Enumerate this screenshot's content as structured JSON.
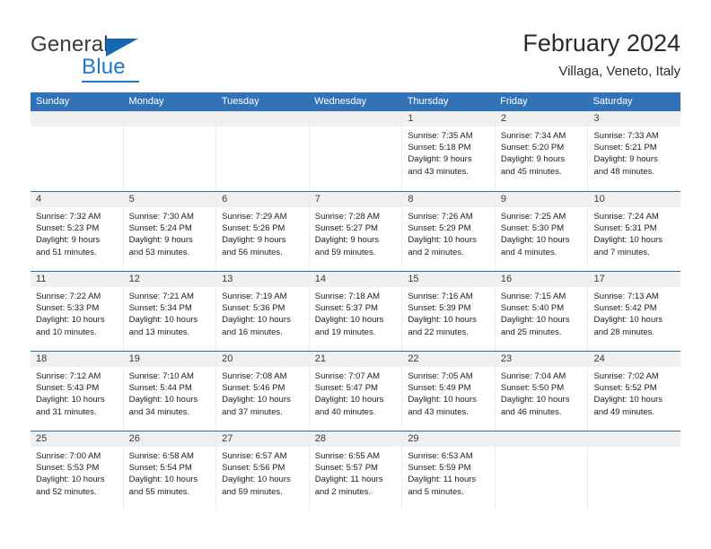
{
  "brand": {
    "name_top": "General",
    "name_bottom": "Blue",
    "accent_color": "#2277c8",
    "triangle_color": "#1667b2"
  },
  "header": {
    "title": "February 2024",
    "subtitle": "Villaga, Veneto, Italy"
  },
  "calendar": {
    "header_color": "#3273b8",
    "weekdays": [
      "Sunday",
      "Monday",
      "Tuesday",
      "Wednesday",
      "Thursday",
      "Friday",
      "Saturday"
    ],
    "weeks": [
      [
        {
          "day": "",
          "sunrise": "",
          "sunset": "",
          "daylight_line1": "",
          "daylight_line2": ""
        },
        {
          "day": "",
          "sunrise": "",
          "sunset": "",
          "daylight_line1": "",
          "daylight_line2": ""
        },
        {
          "day": "",
          "sunrise": "",
          "sunset": "",
          "daylight_line1": "",
          "daylight_line2": ""
        },
        {
          "day": "",
          "sunrise": "",
          "sunset": "",
          "daylight_line1": "",
          "daylight_line2": ""
        },
        {
          "day": "1",
          "sunrise": "Sunrise: 7:35 AM",
          "sunset": "Sunset: 5:18 PM",
          "daylight_line1": "Daylight: 9 hours",
          "daylight_line2": "and 43 minutes."
        },
        {
          "day": "2",
          "sunrise": "Sunrise: 7:34 AM",
          "sunset": "Sunset: 5:20 PM",
          "daylight_line1": "Daylight: 9 hours",
          "daylight_line2": "and 45 minutes."
        },
        {
          "day": "3",
          "sunrise": "Sunrise: 7:33 AM",
          "sunset": "Sunset: 5:21 PM",
          "daylight_line1": "Daylight: 9 hours",
          "daylight_line2": "and 48 minutes."
        }
      ],
      [
        {
          "day": "4",
          "sunrise": "Sunrise: 7:32 AM",
          "sunset": "Sunset: 5:23 PM",
          "daylight_line1": "Daylight: 9 hours",
          "daylight_line2": "and 51 minutes."
        },
        {
          "day": "5",
          "sunrise": "Sunrise: 7:30 AM",
          "sunset": "Sunset: 5:24 PM",
          "daylight_line1": "Daylight: 9 hours",
          "daylight_line2": "and 53 minutes."
        },
        {
          "day": "6",
          "sunrise": "Sunrise: 7:29 AM",
          "sunset": "Sunset: 5:26 PM",
          "daylight_line1": "Daylight: 9 hours",
          "daylight_line2": "and 56 minutes."
        },
        {
          "day": "7",
          "sunrise": "Sunrise: 7:28 AM",
          "sunset": "Sunset: 5:27 PM",
          "daylight_line1": "Daylight: 9 hours",
          "daylight_line2": "and 59 minutes."
        },
        {
          "day": "8",
          "sunrise": "Sunrise: 7:26 AM",
          "sunset": "Sunset: 5:29 PM",
          "daylight_line1": "Daylight: 10 hours",
          "daylight_line2": "and 2 minutes."
        },
        {
          "day": "9",
          "sunrise": "Sunrise: 7:25 AM",
          "sunset": "Sunset: 5:30 PM",
          "daylight_line1": "Daylight: 10 hours",
          "daylight_line2": "and 4 minutes."
        },
        {
          "day": "10",
          "sunrise": "Sunrise: 7:24 AM",
          "sunset": "Sunset: 5:31 PM",
          "daylight_line1": "Daylight: 10 hours",
          "daylight_line2": "and 7 minutes."
        }
      ],
      [
        {
          "day": "11",
          "sunrise": "Sunrise: 7:22 AM",
          "sunset": "Sunset: 5:33 PM",
          "daylight_line1": "Daylight: 10 hours",
          "daylight_line2": "and 10 minutes."
        },
        {
          "day": "12",
          "sunrise": "Sunrise: 7:21 AM",
          "sunset": "Sunset: 5:34 PM",
          "daylight_line1": "Daylight: 10 hours",
          "daylight_line2": "and 13 minutes."
        },
        {
          "day": "13",
          "sunrise": "Sunrise: 7:19 AM",
          "sunset": "Sunset: 5:36 PM",
          "daylight_line1": "Daylight: 10 hours",
          "daylight_line2": "and 16 minutes."
        },
        {
          "day": "14",
          "sunrise": "Sunrise: 7:18 AM",
          "sunset": "Sunset: 5:37 PM",
          "daylight_line1": "Daylight: 10 hours",
          "daylight_line2": "and 19 minutes."
        },
        {
          "day": "15",
          "sunrise": "Sunrise: 7:16 AM",
          "sunset": "Sunset: 5:39 PM",
          "daylight_line1": "Daylight: 10 hours",
          "daylight_line2": "and 22 minutes."
        },
        {
          "day": "16",
          "sunrise": "Sunrise: 7:15 AM",
          "sunset": "Sunset: 5:40 PM",
          "daylight_line1": "Daylight: 10 hours",
          "daylight_line2": "and 25 minutes."
        },
        {
          "day": "17",
          "sunrise": "Sunrise: 7:13 AM",
          "sunset": "Sunset: 5:42 PM",
          "daylight_line1": "Daylight: 10 hours",
          "daylight_line2": "and 28 minutes."
        }
      ],
      [
        {
          "day": "18",
          "sunrise": "Sunrise: 7:12 AM",
          "sunset": "Sunset: 5:43 PM",
          "daylight_line1": "Daylight: 10 hours",
          "daylight_line2": "and 31 minutes."
        },
        {
          "day": "19",
          "sunrise": "Sunrise: 7:10 AM",
          "sunset": "Sunset: 5:44 PM",
          "daylight_line1": "Daylight: 10 hours",
          "daylight_line2": "and 34 minutes."
        },
        {
          "day": "20",
          "sunrise": "Sunrise: 7:08 AM",
          "sunset": "Sunset: 5:46 PM",
          "daylight_line1": "Daylight: 10 hours",
          "daylight_line2": "and 37 minutes."
        },
        {
          "day": "21",
          "sunrise": "Sunrise: 7:07 AM",
          "sunset": "Sunset: 5:47 PM",
          "daylight_line1": "Daylight: 10 hours",
          "daylight_line2": "and 40 minutes."
        },
        {
          "day": "22",
          "sunrise": "Sunrise: 7:05 AM",
          "sunset": "Sunset: 5:49 PM",
          "daylight_line1": "Daylight: 10 hours",
          "daylight_line2": "and 43 minutes."
        },
        {
          "day": "23",
          "sunrise": "Sunrise: 7:04 AM",
          "sunset": "Sunset: 5:50 PM",
          "daylight_line1": "Daylight: 10 hours",
          "daylight_line2": "and 46 minutes."
        },
        {
          "day": "24",
          "sunrise": "Sunrise: 7:02 AM",
          "sunset": "Sunset: 5:52 PM",
          "daylight_line1": "Daylight: 10 hours",
          "daylight_line2": "and 49 minutes."
        }
      ],
      [
        {
          "day": "25",
          "sunrise": "Sunrise: 7:00 AM",
          "sunset": "Sunset: 5:53 PM",
          "daylight_line1": "Daylight: 10 hours",
          "daylight_line2": "and 52 minutes."
        },
        {
          "day": "26",
          "sunrise": "Sunrise: 6:58 AM",
          "sunset": "Sunset: 5:54 PM",
          "daylight_line1": "Daylight: 10 hours",
          "daylight_line2": "and 55 minutes."
        },
        {
          "day": "27",
          "sunrise": "Sunrise: 6:57 AM",
          "sunset": "Sunset: 5:56 PM",
          "daylight_line1": "Daylight: 10 hours",
          "daylight_line2": "and 59 minutes."
        },
        {
          "day": "28",
          "sunrise": "Sunrise: 6:55 AM",
          "sunset": "Sunset: 5:57 PM",
          "daylight_line1": "Daylight: 11 hours",
          "daylight_line2": "and 2 minutes."
        },
        {
          "day": "29",
          "sunrise": "Sunrise: 6:53 AM",
          "sunset": "Sunset: 5:59 PM",
          "daylight_line1": "Daylight: 11 hours",
          "daylight_line2": "and 5 minutes."
        },
        {
          "day": "",
          "sunrise": "",
          "sunset": "",
          "daylight_line1": "",
          "daylight_line2": ""
        },
        {
          "day": "",
          "sunrise": "",
          "sunset": "",
          "daylight_line1": "",
          "daylight_line2": ""
        }
      ]
    ]
  }
}
